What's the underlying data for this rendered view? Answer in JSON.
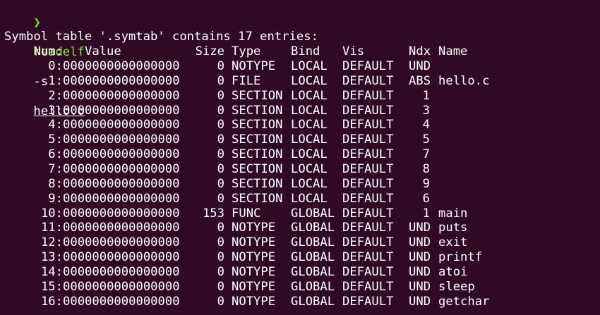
{
  "prompt": {
    "arrow": "❯",
    "command": "readelf",
    "flag": "-s",
    "file": "hello.o"
  },
  "table_title": "Symbol table '.symtab' contains 17 entries:",
  "headers": {
    "num": "Num:",
    "value": "Value",
    "size": "Size",
    "type": "Type",
    "bind": "Bind",
    "vis": "Vis",
    "ndx": "Ndx",
    "name": "Name"
  },
  "rows": [
    {
      "num": "0:",
      "value": "0000000000000000",
      "size": "0",
      "type": "NOTYPE",
      "bind": "LOCAL",
      "vis": "DEFAULT",
      "ndx": "UND",
      "name": ""
    },
    {
      "num": "1:",
      "value": "0000000000000000",
      "size": "0",
      "type": "FILE",
      "bind": "LOCAL",
      "vis": "DEFAULT",
      "ndx": "ABS",
      "name": "hello.c"
    },
    {
      "num": "2:",
      "value": "0000000000000000",
      "size": "0",
      "type": "SECTION",
      "bind": "LOCAL",
      "vis": "DEFAULT",
      "ndx": "1",
      "name": ""
    },
    {
      "num": "3:",
      "value": "0000000000000000",
      "size": "0",
      "type": "SECTION",
      "bind": "LOCAL",
      "vis": "DEFAULT",
      "ndx": "3",
      "name": ""
    },
    {
      "num": "4:",
      "value": "0000000000000000",
      "size": "0",
      "type": "SECTION",
      "bind": "LOCAL",
      "vis": "DEFAULT",
      "ndx": "4",
      "name": ""
    },
    {
      "num": "5:",
      "value": "0000000000000000",
      "size": "0",
      "type": "SECTION",
      "bind": "LOCAL",
      "vis": "DEFAULT",
      "ndx": "5",
      "name": ""
    },
    {
      "num": "6:",
      "value": "0000000000000000",
      "size": "0",
      "type": "SECTION",
      "bind": "LOCAL",
      "vis": "DEFAULT",
      "ndx": "7",
      "name": ""
    },
    {
      "num": "7:",
      "value": "0000000000000000",
      "size": "0",
      "type": "SECTION",
      "bind": "LOCAL",
      "vis": "DEFAULT",
      "ndx": "8",
      "name": ""
    },
    {
      "num": "8:",
      "value": "0000000000000000",
      "size": "0",
      "type": "SECTION",
      "bind": "LOCAL",
      "vis": "DEFAULT",
      "ndx": "9",
      "name": ""
    },
    {
      "num": "9:",
      "value": "0000000000000000",
      "size": "0",
      "type": "SECTION",
      "bind": "LOCAL",
      "vis": "DEFAULT",
      "ndx": "6",
      "name": ""
    },
    {
      "num": "10:",
      "value": "0000000000000000",
      "size": "153",
      "type": "FUNC",
      "bind": "GLOBAL",
      "vis": "DEFAULT",
      "ndx": "1",
      "name": "main"
    },
    {
      "num": "11:",
      "value": "0000000000000000",
      "size": "0",
      "type": "NOTYPE",
      "bind": "GLOBAL",
      "vis": "DEFAULT",
      "ndx": "UND",
      "name": "puts"
    },
    {
      "num": "12:",
      "value": "0000000000000000",
      "size": "0",
      "type": "NOTYPE",
      "bind": "GLOBAL",
      "vis": "DEFAULT",
      "ndx": "UND",
      "name": "exit"
    },
    {
      "num": "13:",
      "value": "0000000000000000",
      "size": "0",
      "type": "NOTYPE",
      "bind": "GLOBAL",
      "vis": "DEFAULT",
      "ndx": "UND",
      "name": "printf"
    },
    {
      "num": "14:",
      "value": "0000000000000000",
      "size": "0",
      "type": "NOTYPE",
      "bind": "GLOBAL",
      "vis": "DEFAULT",
      "ndx": "UND",
      "name": "atoi"
    },
    {
      "num": "15:",
      "value": "0000000000000000",
      "size": "0",
      "type": "NOTYPE",
      "bind": "GLOBAL",
      "vis": "DEFAULT",
      "ndx": "UND",
      "name": "sleep"
    },
    {
      "num": "16:",
      "value": "0000000000000000",
      "size": "0",
      "type": "NOTYPE",
      "bind": "GLOBAL",
      "vis": "DEFAULT",
      "ndx": "UND",
      "name": "getchar"
    }
  ],
  "colors": {
    "background": "#300a24",
    "text": "#ffffff",
    "prompt_green": "#8ae234"
  }
}
